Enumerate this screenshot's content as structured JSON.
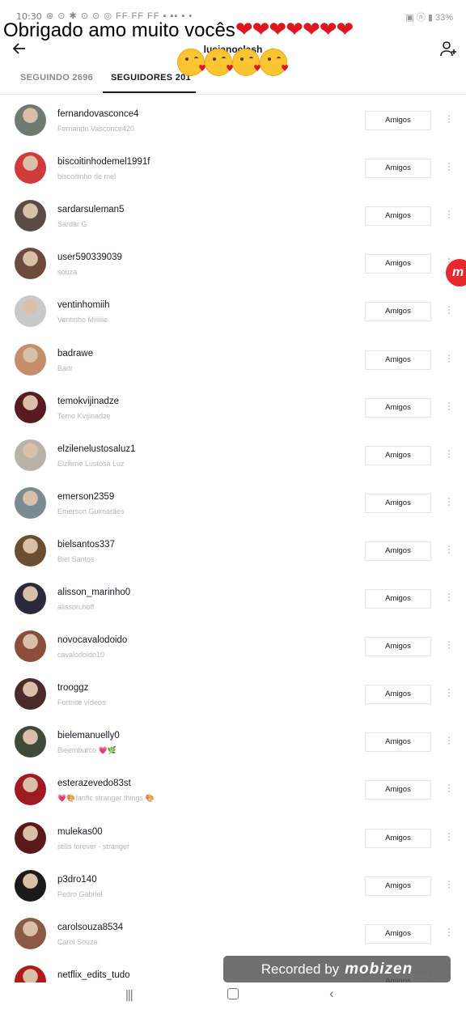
{
  "status_bar": {
    "time": "10:30",
    "icons": "⊛ ⊙ ✱ ⊙ ⊙ ◎ FF FF FF ▪ ▪▪ ▪ •",
    "right": "▣ ⓝ ▮ 33%"
  },
  "overlay": {
    "caption_text": "Obrigado amo muito vocês",
    "hearts": "❤❤❤❤❤❤❤"
  },
  "header": {
    "username": "lucianoclash"
  },
  "tabs": {
    "following": "SEGUINDO 2696",
    "followers": "SEGUIDORES 201"
  },
  "followers": [
    {
      "username": "fernandovasconce4",
      "nickname": "Fernando Vasconce420",
      "button": "Amigos",
      "avatar_color": "#6f7a72"
    },
    {
      "username": "biscoitinhodemel1991f",
      "nickname": "biscoitinho de mel",
      "button": "Amigos",
      "avatar_color": "#d03a3a"
    },
    {
      "username": "sardarsuleman5",
      "nickname": "Sardar G",
      "button": "Amigos",
      "avatar_color": "#5b4b46"
    },
    {
      "username": "user590339039",
      "nickname": "souza",
      "button": "Amigos",
      "avatar_color": "#6e4a3c"
    },
    {
      "username": "ventinhomiih",
      "nickname": "Ventinho Miiiiiie",
      "button": "Amigos",
      "avatar_color": "#c9c9c9"
    },
    {
      "username": "badrawe",
      "nickname": "Badr",
      "button": "Amigos",
      "avatar_color": "#c58d6a"
    },
    {
      "username": "temokvijinadze",
      "nickname": "Temo Kvijinadze",
      "button": "Amigos",
      "avatar_color": "#5a1a22"
    },
    {
      "username": "elzilenelustosaluz1",
      "nickname": "Elzilene Lustosa Luz",
      "button": "Amigos",
      "avatar_color": "#b9b2a6"
    },
    {
      "username": "emerson2359",
      "nickname": "Emerson Guimarães",
      "button": "Amigos",
      "avatar_color": "#7a8c92"
    },
    {
      "username": "bielsantos337",
      "nickname": "Biel Santos",
      "button": "Amigos",
      "avatar_color": "#6b4e2f"
    },
    {
      "username": "alisson_marinho0",
      "nickname": "alisson.hoff",
      "button": "Amigos",
      "avatar_color": "#2a2a3a"
    },
    {
      "username": "novocavalodoido",
      "nickname": "cavalodoido10",
      "button": "Amigos",
      "avatar_color": "#8a4e3a"
    },
    {
      "username": "trooggz",
      "nickname": "Fortnite vídeos",
      "button": "Amigos",
      "avatar_color": "#4a2a2a"
    },
    {
      "username": "bielemanuelly0",
      "nickname": "Bieemburco 💗🌿",
      "button": "Amigos",
      "avatar_color": "#3f4a3a"
    },
    {
      "username": "esterazevedo83st",
      "nickname": "💗🎨fanfic stranger things 🎨",
      "button": "Amigos",
      "avatar_color": "#a01a22"
    },
    {
      "username": "mulekas00",
      "nickname": "stills forever - stranger",
      "button": "Amigos",
      "avatar_color": "#5a1a1a"
    },
    {
      "username": "p3dro140",
      "nickname": "Pedro Gabriel",
      "button": "Amigos",
      "avatar_color": "#1a1a1a"
    },
    {
      "username": "carolsouza8534",
      "nickname": "Carol Souza",
      "button": "Amigos",
      "avatar_color": "#8a5a44"
    },
    {
      "username": "netflix_edits_tudo",
      "nickname": "",
      "button": "Amigos",
      "avatar_color": "#b11a1a"
    }
  ],
  "floating": {
    "bubble_letter": "m"
  },
  "recording_banner": {
    "prefix": "Recorded by",
    "brand": "mobizen"
  },
  "nav_bar": {
    "recent": "|||",
    "back": "‹"
  }
}
